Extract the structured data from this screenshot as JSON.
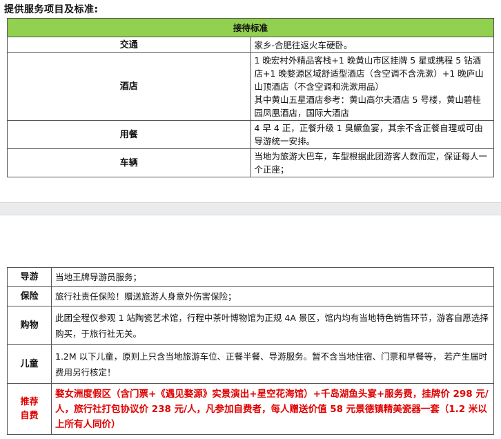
{
  "heading": "提供服务项目及标准:",
  "table1": {
    "header": "接待标准",
    "rows": {
      "traffic": {
        "label": "交通",
        "value": "家乡-合肥往返火车硬卧。"
      },
      "hotel": {
        "label": "酒店",
        "line1": "1 晚宏村外精品客栈+1 晚黄山市区挂牌 5 星或携程 5 钻酒店+1 晚婺源区域舒适型酒店（含空调不含洗漱）+1 晚庐山山顶酒店（不含空调和洗漱用品）",
        "line2": "其中黄山五星酒店参考：黄山高尔夫酒店 5 号楼，黄山碧桂园凤凰酒店，国际大酒店"
      },
      "meals": {
        "label": "用餐",
        "value": "4 早 4 正，正餐升级 1 臭鳜鱼宴，其余不含正餐自理或可由导游统一安排。"
      },
      "vehicle": {
        "label": "车辆",
        "value": "当地为旅游大巴车，车型根据此团游客人数而定，保证每人一个正座；"
      }
    }
  },
  "table2": {
    "rows": {
      "guide": {
        "label": "导游",
        "value": "当地王牌导游员服务；"
      },
      "insurance": {
        "label": "保险",
        "value": "旅行社责任保险！赠送旅游人身意外伤害保险；"
      },
      "shopping": {
        "label": "购物",
        "value": "此团全程仅参观 1 站陶瓷艺术馆，行程中茶叶博物馆为正规 4A 景区，馆内均有当地特色销售环节，游客自愿选择购买，于旅行社无关。"
      },
      "children": {
        "label": "儿童",
        "value": "1.2M 以下儿童，原则上只含当地旅游车位、正餐半餐、导游服务。暂不含当地住宿、门票和早餐等， 若产生届时费用另行核定！"
      },
      "recommended": {
        "label_line1": "推荐",
        "label_line2": "自费",
        "value": "婺女洲度假区（含门票+《遇见婺源》实景演出+星空花海馆）+千岛湖鱼头宴+服务费，挂牌价 298 元/人，旅行社打包协议价 238 元/人，凡参加自费者，每人赠送价值 58 元景德镇精美瓷器一套（1.2 米以上所有人同价）"
      }
    }
  },
  "colors": {
    "header_bg": "#92d050",
    "highlight_red": "#e00000",
    "divider_band": "#eaebed"
  }
}
